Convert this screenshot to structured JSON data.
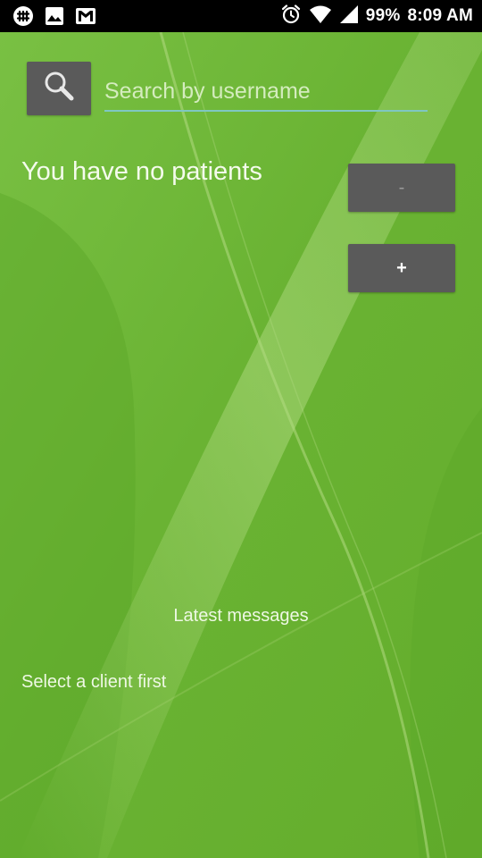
{
  "status_bar": {
    "battery": "99%",
    "time": "8:09 AM",
    "icons": [
      "slack-icon",
      "gallery-icon",
      "gmail-icon",
      "alarm-icon",
      "wifi-icon",
      "signal-icon"
    ]
  },
  "search": {
    "placeholder": "Search by username",
    "value": ""
  },
  "patients": {
    "empty_text": "You have no patients",
    "remove_label": "-",
    "add_label": "+"
  },
  "messages": {
    "title": "Latest messages",
    "empty_text": "Select a client first"
  },
  "colors": {
    "background": "#69b232",
    "button": "#5a5a5a",
    "input_underline": "#7fc7c2",
    "status_bar": "#000000"
  }
}
